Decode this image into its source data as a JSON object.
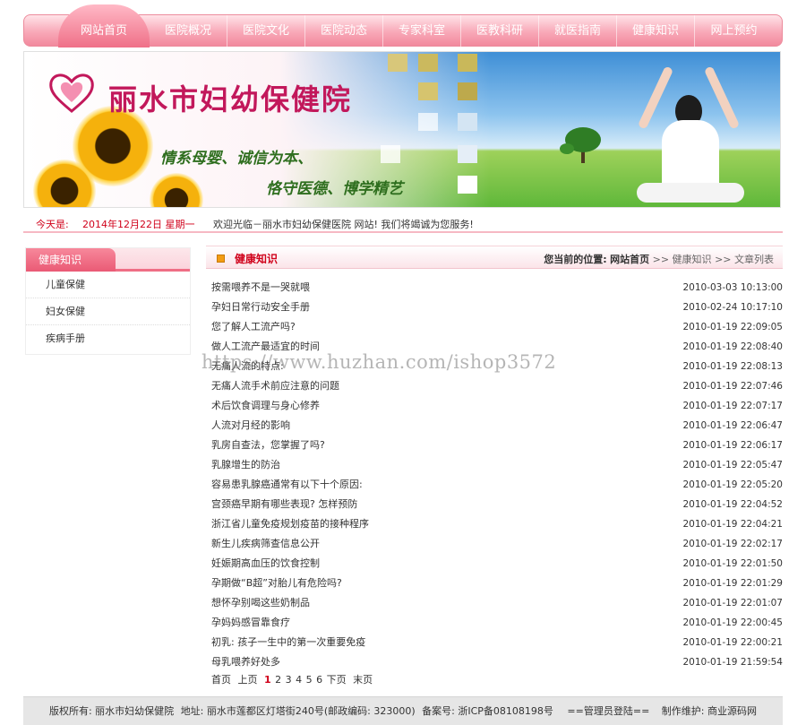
{
  "nav": {
    "items": [
      "网站首页",
      "医院概况",
      "医院文化",
      "医院动态",
      "专家科室",
      "医教科研",
      "就医指南",
      "健康知识",
      "网上预约"
    ]
  },
  "banner": {
    "hospital_name": "丽水市妇幼保健院",
    "slogan_line1": "情系母婴、诚信为本、",
    "slogan_line2": "恪守医德、博学精艺"
  },
  "datebar": {
    "today_label": "今天是:",
    "today_value": "2014年12月22日 星期一",
    "welcome": "欢迎光临－丽水市妇幼保健医院 网站! 我们将竭诚为您服务!"
  },
  "sidebar": {
    "title": "健康知识",
    "items": [
      "儿童保健",
      "妇女保健",
      "疾病手册"
    ]
  },
  "main": {
    "title": "健康知识",
    "breadcrumb": {
      "prefix": "您当前的位置:",
      "home": "网站首页",
      "level1": ">> 健康知识",
      "level2": ">> 文章列表"
    },
    "articles": [
      {
        "title": "按需喂养不是一哭就喂",
        "date": "2010-03-03 10:13:00"
      },
      {
        "title": "孕妇日常行动安全手册",
        "date": "2010-02-24 10:17:10"
      },
      {
        "title": "您了解人工流产吗?",
        "date": "2010-01-19 22:09:05"
      },
      {
        "title": "做人工流产最适宜的时间",
        "date": "2010-01-19 22:08:40"
      },
      {
        "title": "无痛人流的特点:",
        "date": "2010-01-19 22:08:13"
      },
      {
        "title": "无痛人流手术前应注意的问题",
        "date": "2010-01-19 22:07:46"
      },
      {
        "title": "术后饮食调理与身心修养",
        "date": "2010-01-19 22:07:17"
      },
      {
        "title": "人流对月经的影响",
        "date": "2010-01-19 22:06:47"
      },
      {
        "title": "乳房自查法，您掌握了吗?",
        "date": "2010-01-19 22:06:17"
      },
      {
        "title": "乳腺增生的防治",
        "date": "2010-01-19 22:05:47"
      },
      {
        "title": "容易患乳腺癌通常有以下十个原因:",
        "date": "2010-01-19 22:05:20"
      },
      {
        "title": "宫颈癌早期有哪些表现? 怎样预防",
        "date": "2010-01-19 22:04:52"
      },
      {
        "title": "浙江省儿童免疫规划疫苗的接种程序",
        "date": "2010-01-19 22:04:21"
      },
      {
        "title": "新生儿疾病筛查信息公开",
        "date": "2010-01-19 22:02:17"
      },
      {
        "title": "妊娠期高血压的饮食控制",
        "date": "2010-01-19 22:01:50"
      },
      {
        "title": "孕期做“B超”对胎儿有危险吗?",
        "date": "2010-01-19 22:01:29"
      },
      {
        "title": "想怀孕别喝这些奶制品",
        "date": "2010-01-19 22:01:07"
      },
      {
        "title": "孕妈妈感冒靠食疗",
        "date": "2010-01-19 22:00:45"
      },
      {
        "title": "初乳: 孩子一生中的第一次重要免疫",
        "date": "2010-01-19 22:00:21"
      },
      {
        "title": "母乳喂养好处多",
        "date": "2010-01-19 21:59:54"
      }
    ],
    "pager": {
      "first": "首页",
      "prev": "上页",
      "pages": [
        "1",
        "2",
        "3",
        "4",
        "5",
        "6"
      ],
      "current": "1",
      "next": "下页",
      "last": "末页"
    }
  },
  "watermark": "https://www.huzhan.com/ishop3572",
  "footer": {
    "copyright": "版权所有: 丽水市妇幼保健院",
    "address": "地址: 丽水市莲都区灯塔街240号(邮政编码: 323000)",
    "icp": "备案号: 浙ICP备08108198号",
    "admin": "==管理员登陆==",
    "maintainer": "制作维护: 商业源码网"
  },
  "colors": {
    "accent": "#d0021b",
    "nav_pink": "#f2899d",
    "sidebar_pink": "#ea5a75"
  }
}
